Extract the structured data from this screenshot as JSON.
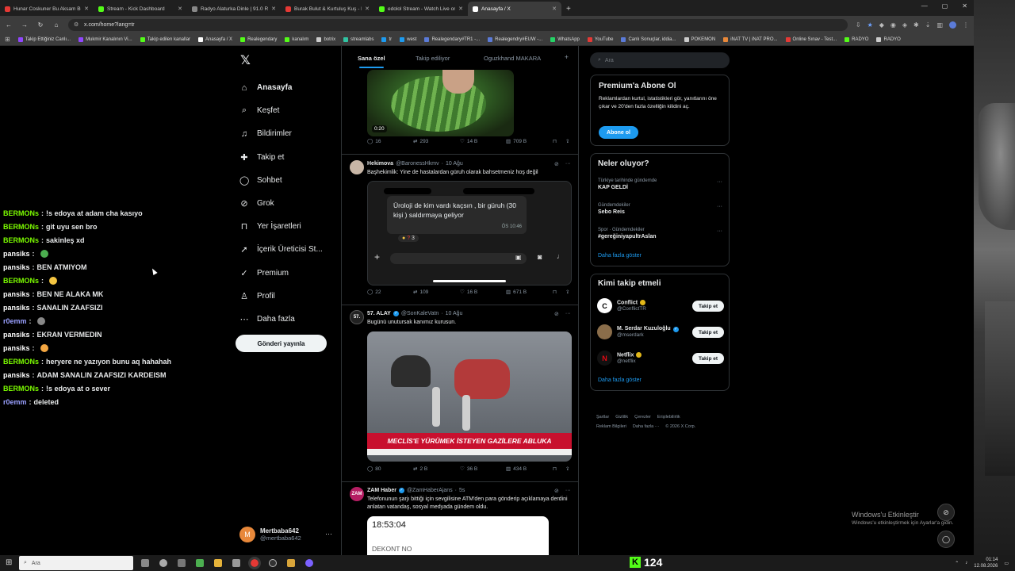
{
  "browser": {
    "tabs": [
      {
        "label": "Hunar Coskuner Bu Aksam Bu...",
        "fav": "#e53935"
      },
      {
        "label": "Stream - Kick Dashboard",
        "fav": "#53fc18"
      },
      {
        "label": "Radyo Alaturka Dinle | 91.0 Ra...",
        "fav": "#888888"
      },
      {
        "label": "Burak Bulut & Kurtuluş Kuş - M...",
        "fav": "#e53935"
      },
      {
        "label": "edolol Stream - Watch Live on...",
        "fav": "#53fc18"
      },
      {
        "label": "Anasayfa / X",
        "fav": "#ffffff"
      }
    ],
    "url": "x.com/home?lang=tr",
    "bookmarks": [
      {
        "label": "Takip Ettiğiniz Canlı...",
        "color": "#9146ff"
      },
      {
        "label": "Mukmir Kanalının Vi...",
        "color": "#9146ff"
      },
      {
        "label": "Takip edilen kanallar",
        "color": "#53fc18"
      },
      {
        "label": "Anasayfa / X",
        "color": "#ffffff"
      },
      {
        "label": "Realegendary",
        "color": "#53fc18"
      },
      {
        "label": "kanalım",
        "color": "#53fc18"
      },
      {
        "label": "botrix",
        "color": "#cccccc"
      },
      {
        "label": "streamlabs",
        "color": "#31c3a2"
      },
      {
        "label": "tr",
        "color": "#1d9bf0"
      },
      {
        "label": "west",
        "color": "#1d9bf0"
      },
      {
        "label": "Realegendary#TR1 -...",
        "color": "#5b7bd8"
      },
      {
        "label": "Realegendry#EUW -...",
        "color": "#5b7bd8"
      },
      {
        "label": "WhatsApp",
        "color": "#25d366"
      },
      {
        "label": "YouTube",
        "color": "#e53935"
      },
      {
        "label": "Canlı Sonuçlar, iddia...",
        "color": "#5b7bd8"
      },
      {
        "label": "POKEMON",
        "color": "#cccccc"
      },
      {
        "label": "iNAT TV | iNAT PRO...",
        "color": "#e8883a"
      },
      {
        "label": "Online Sınav - Test...",
        "color": "#e53935"
      },
      {
        "label": "RADYO",
        "color": "#53fc18"
      },
      {
        "label": "RADYO",
        "color": "#cccccc"
      }
    ]
  },
  "chat": [
    {
      "user": "BERMONs",
      "color": "#7cfc00",
      "text": "!s edoya at adam cha kasıyo"
    },
    {
      "user": "BERMONs",
      "color": "#7cfc00",
      "text": "git uyu sen bro"
    },
    {
      "user": "BERMONs",
      "color": "#7cfc00",
      "text": "sakinleş xd"
    },
    {
      "user": "pansiks",
      "color": "#ffffff",
      "text": "",
      "emoji": "#4caf50"
    },
    {
      "user": "pansiks",
      "color": "#ffffff",
      "text": "BEN ATMIYOM"
    },
    {
      "user": "BERMONs",
      "color": "#7cfc00",
      "text": "",
      "emoji": "#f4c542"
    },
    {
      "user": "pansiks",
      "color": "#ffffff",
      "text": "BEN NE ALAKA MK"
    },
    {
      "user": "pansiks",
      "color": "#ffffff",
      "text": "SANALIN ZAAFSIZI"
    },
    {
      "user": "r0emm",
      "color": "#9aa0ff",
      "text": "",
      "emoji": "#888888"
    },
    {
      "user": "pansiks",
      "color": "#ffffff",
      "text": "EKRAN VERMEDIN"
    },
    {
      "user": "pansiks",
      "color": "#ffffff",
      "text": "",
      "emoji": "#f4a742"
    },
    {
      "user": "BERMONs",
      "color": "#7cfc00",
      "text": "heryere ne yazıyon bunu aq hahahah"
    },
    {
      "user": "pansiks",
      "color": "#ffffff",
      "text": "ADAM SANALIN ZAAFSIZI KARDEISM"
    },
    {
      "user": "BERMONs",
      "color": "#7cfc00",
      "text": "!s edoya at o sever"
    },
    {
      "user": "r0emm",
      "color": "#9aa0ff",
      "text": "deleted"
    }
  ],
  "nav": {
    "items": [
      {
        "label": "Anasayfa",
        "icon": "home-icon",
        "glyph": "⌂"
      },
      {
        "label": "Keşfet",
        "icon": "search-icon",
        "glyph": "⌕"
      },
      {
        "label": "Bildirimler",
        "icon": "bell-icon",
        "glyph": "♫"
      },
      {
        "label": "Takip et",
        "icon": "follow-icon",
        "glyph": "✚"
      },
      {
        "label": "Sohbet",
        "icon": "chat-icon",
        "glyph": "◯"
      },
      {
        "label": "Grok",
        "icon": "grok-icon",
        "glyph": "⊘"
      },
      {
        "label": "Yer İşaretleri",
        "icon": "bookmark-icon",
        "glyph": "⊓"
      },
      {
        "label": "İçerik Üreticisi St...",
        "icon": "creator-icon",
        "glyph": "➚"
      },
      {
        "label": "Premium",
        "icon": "premium-icon",
        "glyph": "✓"
      },
      {
        "label": "Profil",
        "icon": "profile-icon",
        "glyph": "♙"
      },
      {
        "label": "Daha fazla",
        "icon": "more-icon",
        "glyph": "⋯"
      }
    ],
    "post_label": "Gönderi yayınla",
    "account": {
      "initial": "M",
      "name": "Mertbaba642",
      "handle": "@mertbaba642"
    }
  },
  "feed": {
    "tabs": [
      "Sana özel",
      "Takip ediliyor",
      "Oguzkhand MAKARA"
    ],
    "video_time": "0:20",
    "tweets": [
      {
        "stats": [
          "16",
          "293",
          "14 B",
          "709 B"
        ]
      },
      {
        "name": "Hekimova",
        "handle": "@BaronessHkmv",
        "time": "10 Ağu",
        "text": "Başhekimlik: Yine de hastalardan güruh olarak bahsetmeniz hoş değil",
        "bubble": "Üroloji de kim  vardı kaçsın  , bir güruh (30 kişi ) saldırmaya geliyor",
        "bubble_time": "ÖS 10:46",
        "reaction_count": "3",
        "stats": [
          "22",
          "109",
          "16 B",
          "671 B"
        ]
      },
      {
        "name": "57. ALAY",
        "handle": "@SonKaleVatn",
        "time": "10 Ağu",
        "avatar_text": "57.",
        "text": "Bugünü unutursak kanımız kurusun.",
        "headline": "MECLİS'E YÜRÜMEK İSTEYEN GAZİLERE ABLUKA",
        "stats": [
          "80",
          "2 B",
          "36 B",
          "434 B"
        ]
      },
      {
        "name": "ZAM Haber",
        "handle": "@ZamHaberAjans",
        "time": "5s",
        "avatar_text": "ZAM",
        "text": "Telefonunun şarjı bittiği için sevgilisine ATM'den para gönderip açıklamaya derdini anlatan vatandaş, sosyal medyada gündem oldu.",
        "receipt_time": "18:53:04",
        "receipt_label": "DEKONT NO"
      }
    ]
  },
  "sidebar": {
    "search_placeholder": "Ara",
    "premium": {
      "title": "Premium'a Abone Ol",
      "text": "Reklamlardan kurtul, istatistikleri gör, yanıtlarını öne çıkar ve 20'den fazla özelliğin kilidini aç.",
      "button": "Abone ol"
    },
    "trends": {
      "title": "Neler oluyor?",
      "items": [
        {
          "category": "Türkiye tarihinde gündemde",
          "title": "KAP GELDİ"
        },
        {
          "category": "Gündemdekiler",
          "title": "Sebo Reis"
        },
        {
          "category": "Spor · Gündemdekiler",
          "title": "#gereğiniyapultrAslan"
        }
      ],
      "show_more": "Daha fazla göster"
    },
    "who_to_follow": {
      "title": "Kimi takip etmeli",
      "items": [
        {
          "name": "Conflict",
          "handle": "@ConflictTR",
          "badge": "gold",
          "avatar_color": "#ffffff",
          "avatar_text": "C"
        },
        {
          "name": "M. Serdar Kuzuloğlu",
          "handle": "@mserdark",
          "badge": "blue",
          "avatar_color": "#8a6d4a",
          "avatar_text": ""
        },
        {
          "name": "Netflix",
          "handle": "@netflix",
          "badge": "gold",
          "avatar_color": "#111111",
          "avatar_text": "N"
        }
      ],
      "follow_label": "Takip et",
      "show_more": "Daha fazla göster"
    },
    "footer": [
      "Şartlar",
      "Gizlilik",
      "Çerezler",
      "Erişilebilirlik",
      "Reklam Bilgileri",
      "Daha fazla ···",
      "© 2026 X Corp."
    ]
  },
  "windows": {
    "watermark_title": "Windows'u Etkinleştir",
    "watermark_text": "Windows'u etkinleştirmek için Ayarlar'a gidin.",
    "taskbar_search": "Ara",
    "kick_viewers": "124",
    "time": "01:14",
    "date": "12.08.2026"
  }
}
